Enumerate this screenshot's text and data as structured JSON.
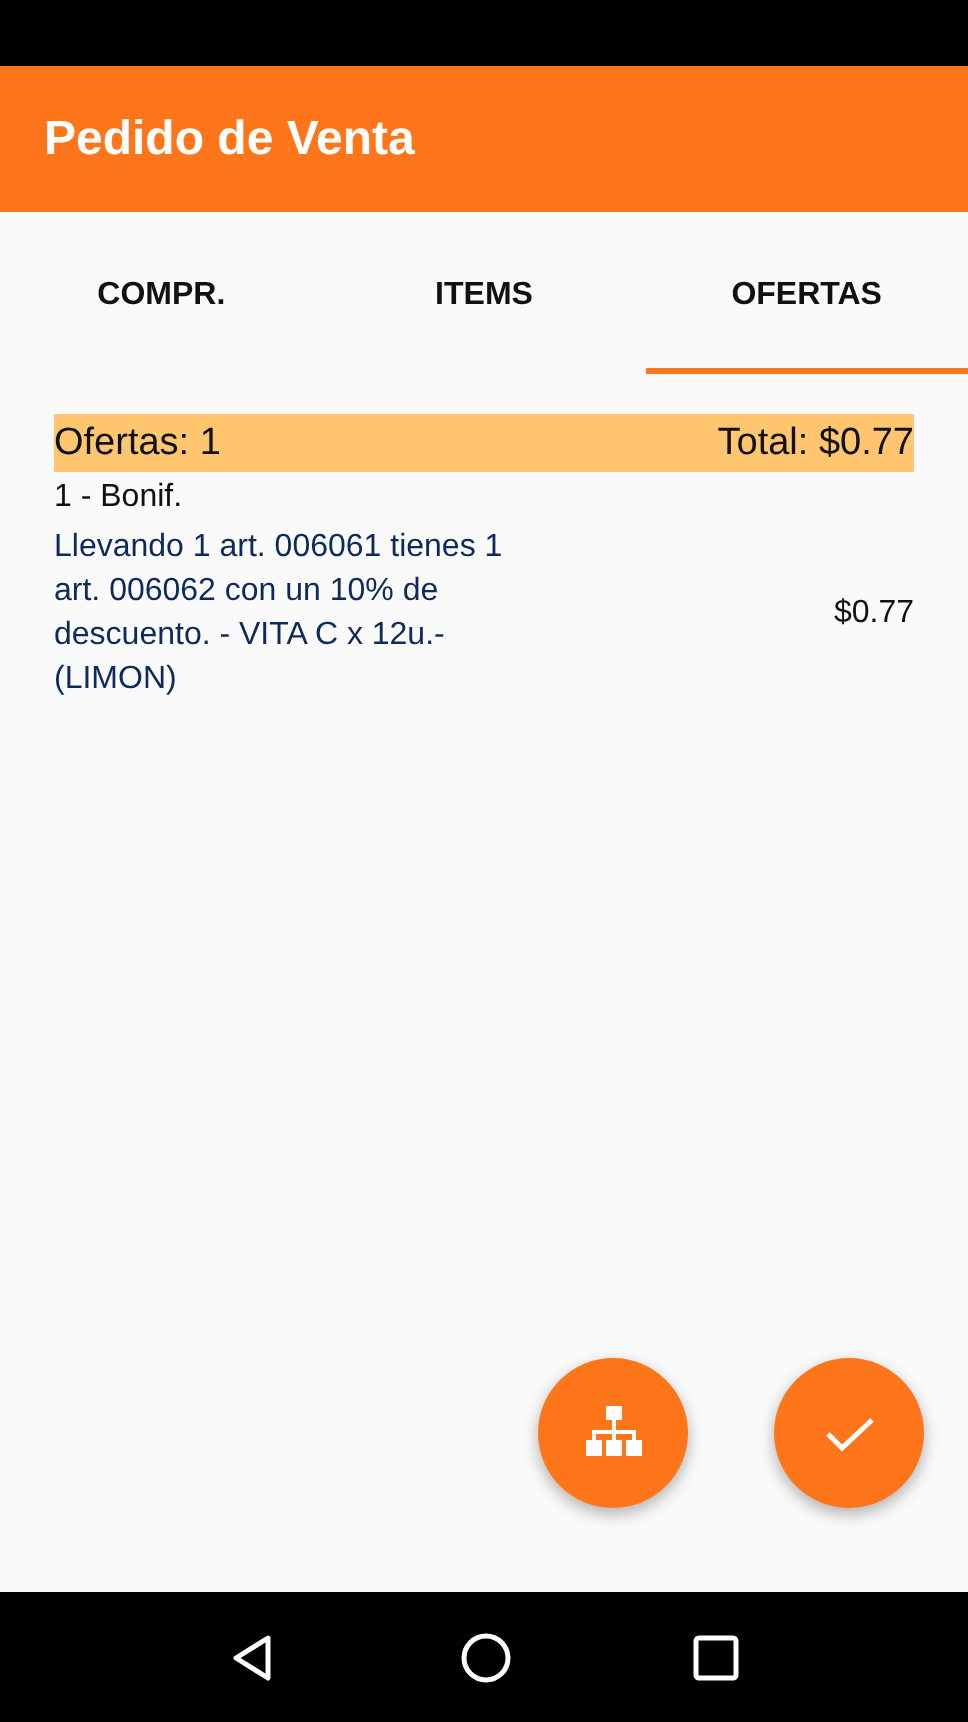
{
  "app_bar": {
    "title": "Pedido de Venta"
  },
  "tabs": [
    {
      "label": "COMPR.",
      "selected": false
    },
    {
      "label": "ITEMS",
      "selected": false
    },
    {
      "label": "OFERTAS",
      "selected": true
    }
  ],
  "summary": {
    "count": "Ofertas: 1",
    "total": "Total: $0.77"
  },
  "offers": [
    {
      "title": "1 - Bonif.",
      "description": "Llevando 1 art. 006061 tienes 1 art. 006062 con un 10% de descuento. -  VITA C x 12u.- (LIMON)",
      "amount": "$0.77"
    }
  ]
}
